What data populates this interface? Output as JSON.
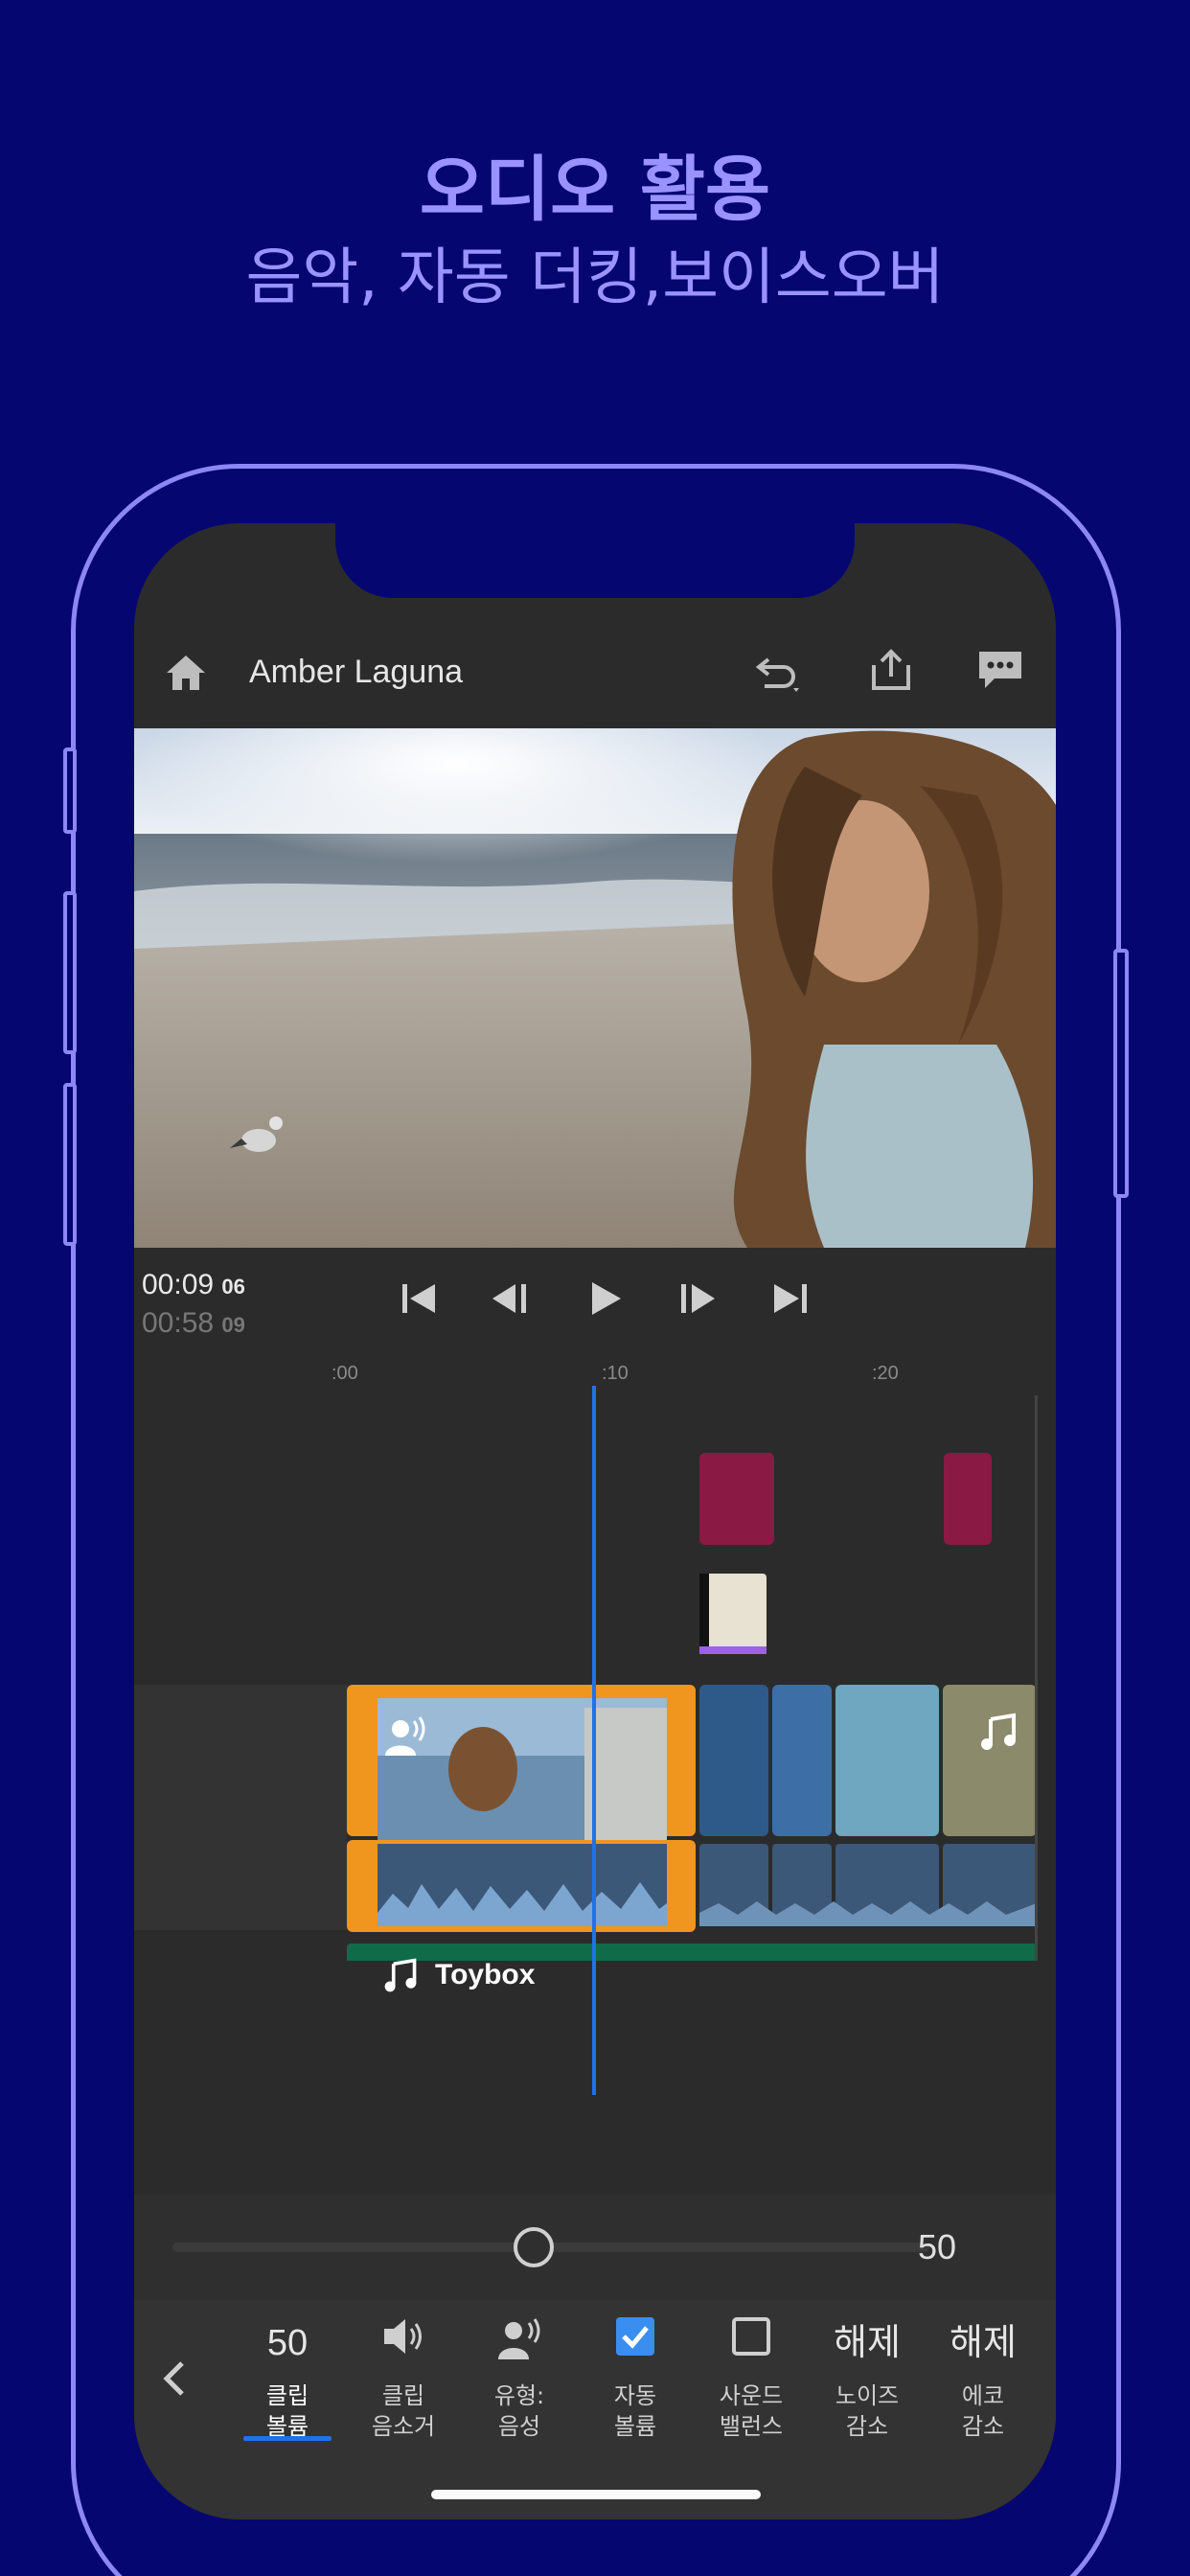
{
  "header": {
    "title": "오디오 활용",
    "subtitle": "음악, 자동 더킹,보이스오버"
  },
  "app": {
    "project_title": "Amber Laguna",
    "icons": [
      "home-icon",
      "undo-icon",
      "share-icon",
      "comment-icon"
    ]
  },
  "playback": {
    "current_time": "00:09",
    "current_frame": "06",
    "total_time": "00:58",
    "total_frame": "09"
  },
  "ruler": {
    "marks": [
      ":00",
      ":10",
      ":20"
    ]
  },
  "timeline": {
    "music_clip_label": "Toybox"
  },
  "volume_slider": {
    "value": 0.5,
    "value_label": "50"
  },
  "tools": [
    {
      "top": "50",
      "label1": "클립",
      "label2": "볼륨",
      "icon": "",
      "active": true
    },
    {
      "top": "",
      "label1": "클립",
      "label2": "음소거",
      "icon": "speaker-icon"
    },
    {
      "top": "",
      "label1": "유형:",
      "label2": "음성",
      "icon": "voice-icon"
    },
    {
      "top": "",
      "label1": "자동",
      "label2": "볼륨",
      "icon": "checkbox-checked-icon"
    },
    {
      "top": "",
      "label1": "사운드",
      "label2": "밸런스",
      "icon": "checkbox-empty-icon"
    },
    {
      "top": "해제",
      "label1": "노이즈",
      "label2": "감소",
      "icon": ""
    },
    {
      "top": "해제",
      "label1": "에코",
      "label2": "감소",
      "icon": ""
    }
  ],
  "colors": {
    "background": "#060670",
    "accent_lavender": "#9a93ff",
    "playhead_blue": "#1e73e8",
    "clip_orange": "#f0961e",
    "music_green": "#0f6b4a",
    "marker_red": "#8a1a44"
  }
}
